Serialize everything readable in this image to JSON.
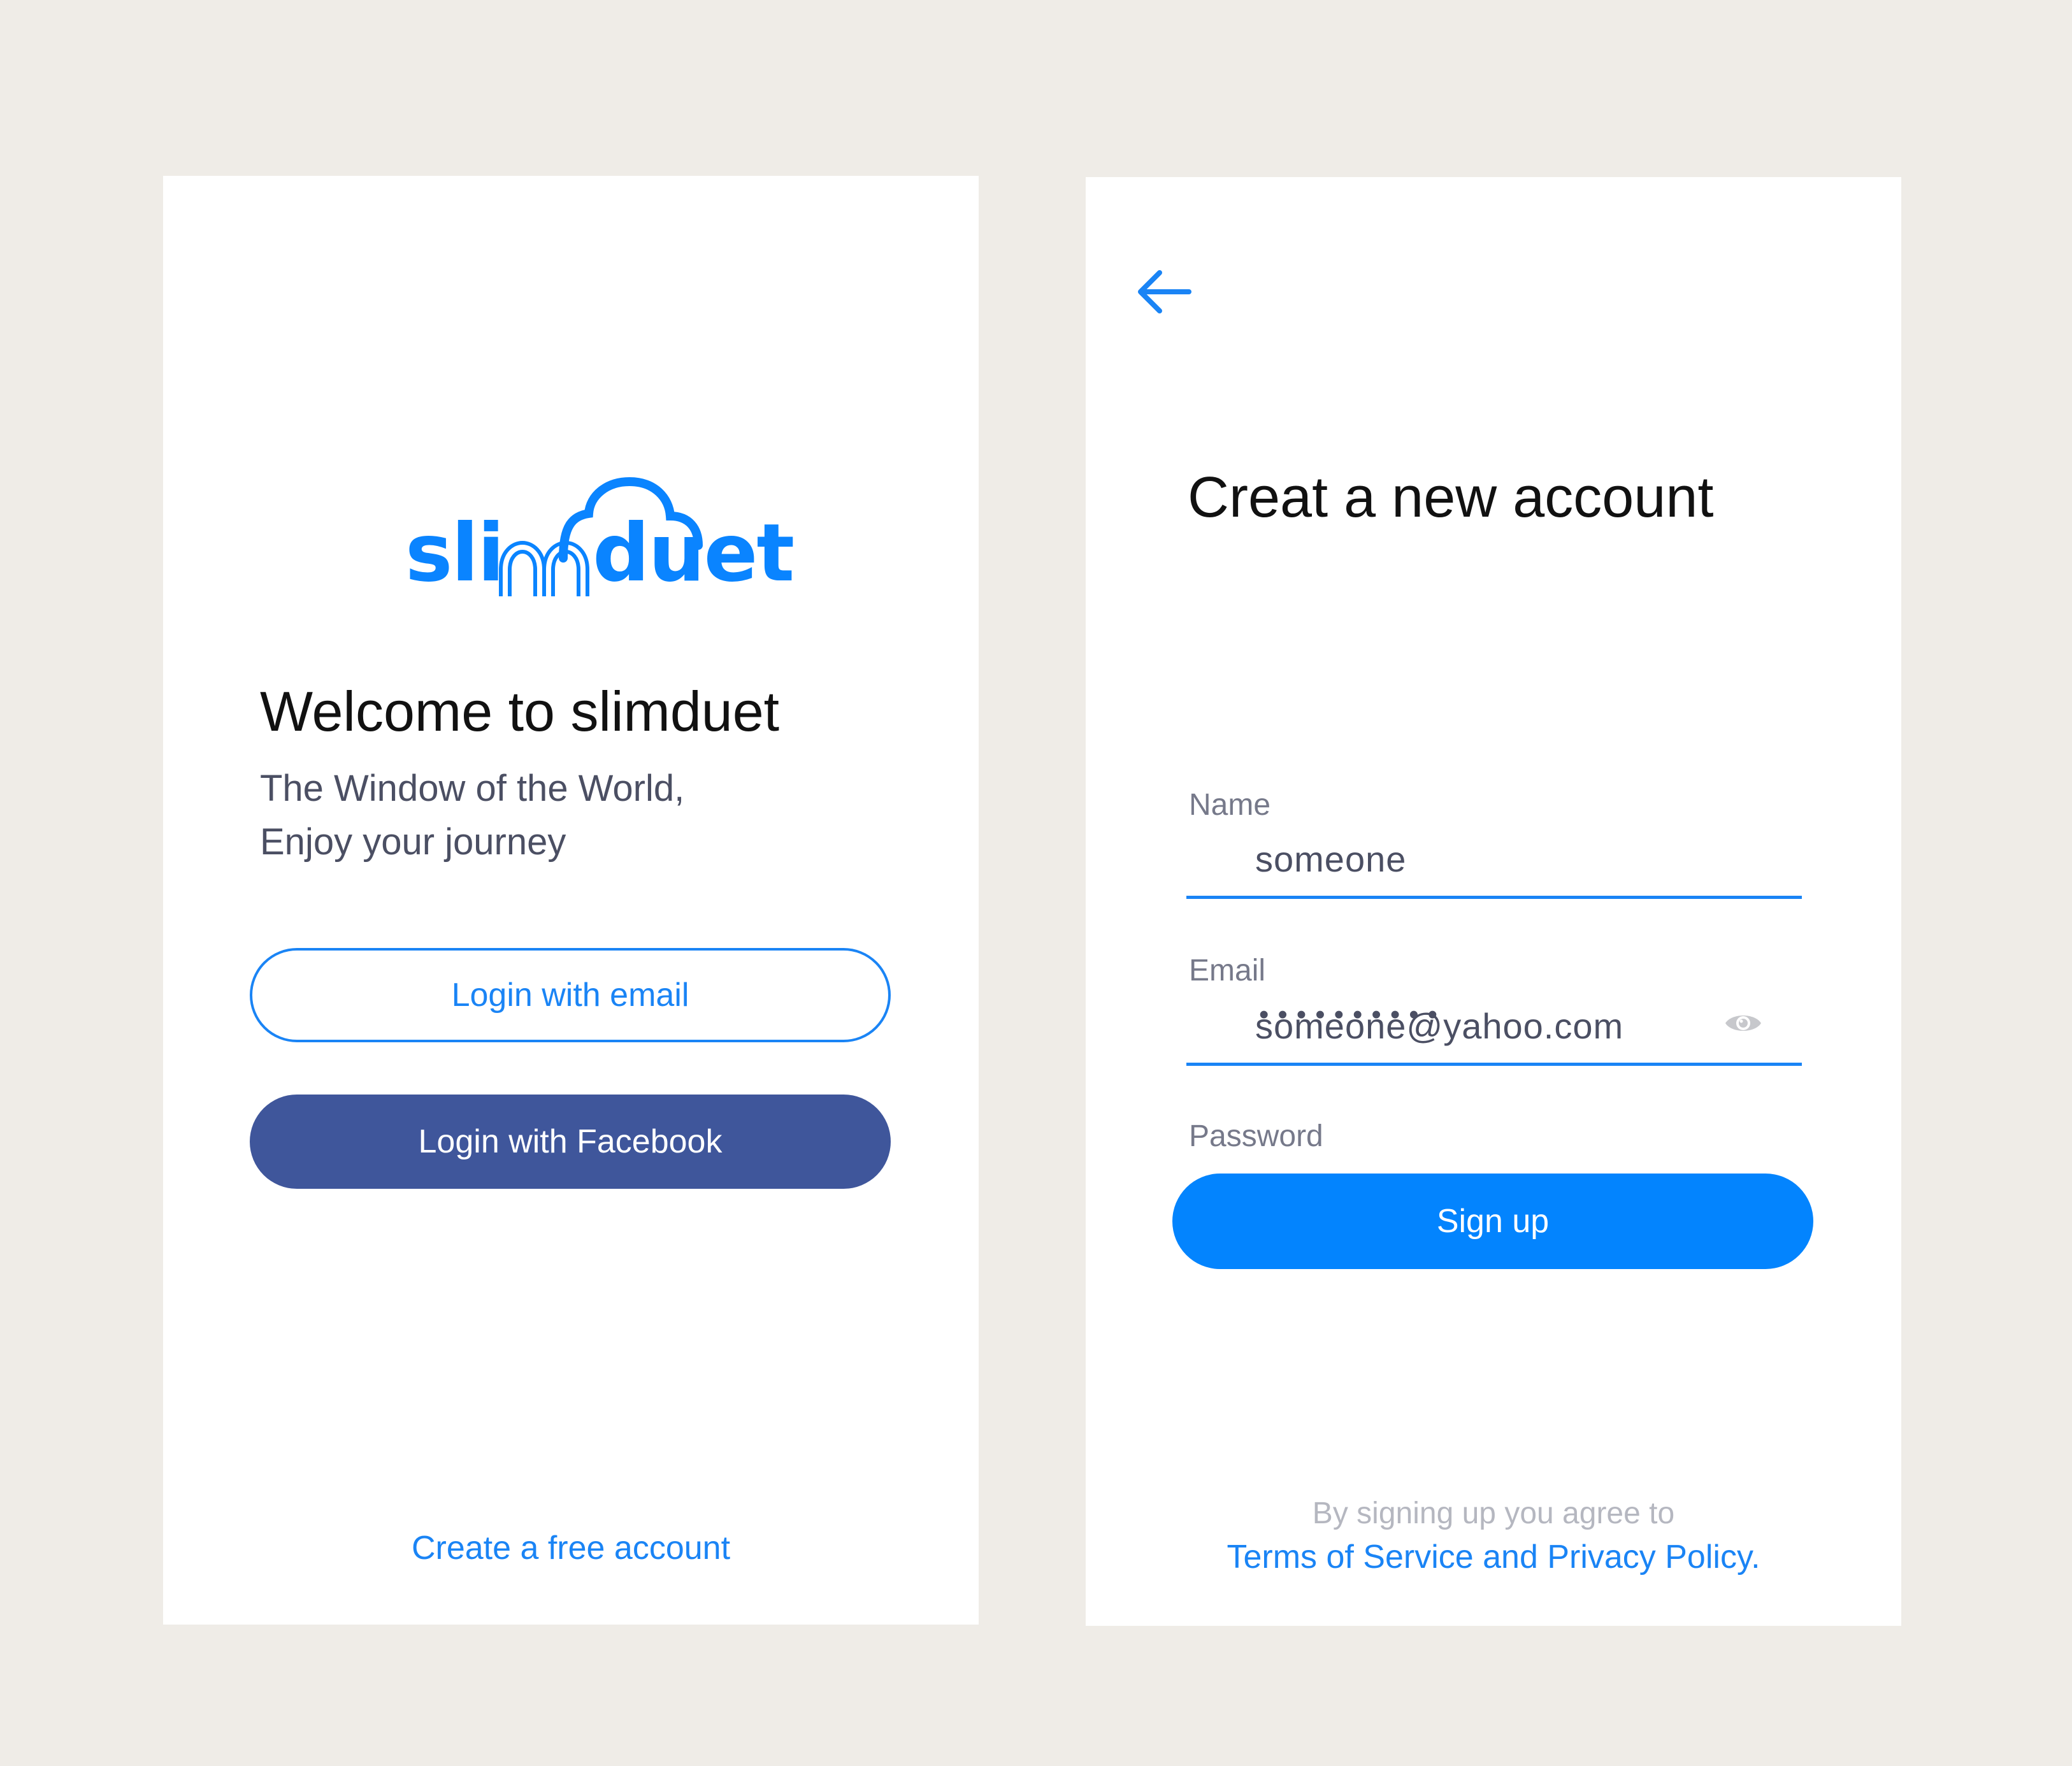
{
  "colors": {
    "background": "#efece7",
    "accent": "#1a84f5",
    "facebook": "#3f569b",
    "signup_button": "#0384fe",
    "muted_text": "#b5b7c0"
  },
  "welcome": {
    "logo": {
      "text": "slimduet",
      "icon": "cloud-icon"
    },
    "title": "Welcome to slimduet",
    "tagline_line1": "The Window of the World,",
    "tagline_line2": "Enjoy your journey",
    "login_email_label": "Login with email",
    "login_facebook_label": "Login with Facebook",
    "create_account_link": "Create a free account"
  },
  "signup": {
    "back_icon": "arrow-left-icon",
    "title": "Creat a new account",
    "fields": {
      "name": {
        "label": "Name",
        "value": "someone"
      },
      "email": {
        "label": "Email",
        "value": "someone@yahoo.com"
      },
      "password": {
        "label": "Password",
        "masked_value": "••••••••••",
        "toggle_icon": "eye-icon"
      }
    },
    "submit_label": "Sign up",
    "agree_text": "By signing up you agree to",
    "terms_link": "Terms of Service and Privacy Policy."
  }
}
